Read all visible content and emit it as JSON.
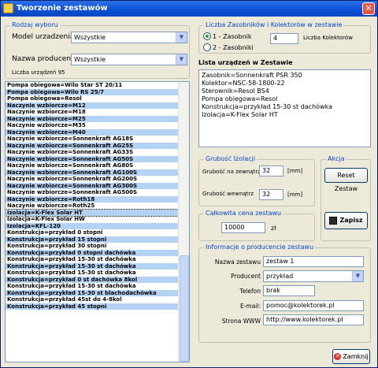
{
  "window": {
    "title": "Tworzenie zestawów",
    "close_glyph": "✕"
  },
  "rodzaj": {
    "title": "Rodzaj wyboru",
    "model_label": "Model urzadzenia",
    "model_value": "Wszystkie",
    "producer_label": "Nazwa producenta",
    "producer_value": "Wszystkie",
    "count_text": "Liczba urządzeń 95"
  },
  "list_items": [
    "Pompa obiegowa=Wilo Star ST 20/11",
    "Pompa obiegowa=Wilo RS 25/7",
    "Pompa obiegowa=Resol",
    "Naczynie wzbiorcze=M12",
    "Naczynie wzbiorcze=M18",
    "Naczynie wzbiorcze=M25",
    "Naczynie wzbiorcze=M35",
    "Naczynie wzbiorcze=M40",
    "Naczynie wzbiorcze=Sonnenkraft AG18S",
    "Naczynie wzbiorcze=Sonnenkraft AG25S",
    "Naczynie wzbiorcze=Sonnenkraft AG33S",
    "Naczynie wzbiorcze=Sonnenkraft AG50S",
    "Naczynie wzbiorcze=Sonnenkraft AG80S",
    "Naczynie wzbiorcze=Sonnenkraft AG100S",
    "Naczynie wzbiorcze=Sonnenkraft AG200S",
    "Naczynie wzbiorcze=Sonnenkraft AG300S",
    "Naczynie wzbiorcze=Sonnenkraft AG500S",
    "Naczynie wzbiorcze=Roth18",
    "Naczynie wzbiorcze=Roth25",
    "Izolacja=K-Flex Solar HT",
    "Izolacja=K-Flex Solar HW",
    "Izolacja=KFL-120",
    "Konstrukcja=przykład 0 stopni",
    "Konstrukcja=przykład 15 stopni",
    "Konstrukcja=przykład 30 stopni",
    "Konstrukcja=przykład 0 stopni dachówka",
    "Konstrukcja=przykład 15-30 st dachówka",
    "Konstrukcja=przykład 15-30 st dachówka",
    "Konstrukcja=przykład 15-30 st dachówka",
    "Konstrukcja=przykład 0 st dachówka 8kol",
    "Konstrukcja=przykład 15-30 st dachówka",
    "Konstrukcja=przykład 15-30 st blachodachówka",
    "Konstrukcja=przykład 45st do 4-8kol",
    "Konstrukcja=przykład 45 stopni"
  ],
  "liczba": {
    "title": "Liczba Zasobników i Kolektorów w  zestawie",
    "radio1": "1 - Zasobnik",
    "radio2": "2 - Zasobniki",
    "kolektory_value": "4",
    "kolektory_label": "Liczba Kolektorów"
  },
  "lista": {
    "title": "Lista urządzeń w Zestawie",
    "lines": [
      "Zasobnik=Sonnenkraft PSR 350",
      "Kolektor=NSC-58-1800-22",
      "Sterownik=Resol BS4",
      "Pompa obiegowa=Resol",
      "Konstrukcja=przykład 15-30 st dachówka",
      "Izolacja=K-Flex Solar HT"
    ]
  },
  "izolacja": {
    "title": "Grubość Izolacji",
    "outer_label": "Grubość na zewnątrz",
    "outer_value": "32",
    "inner_label": "Grubość wewnątrz",
    "inner_value": "32",
    "unit": "[mm]"
  },
  "akcja": {
    "title": "Akcja",
    "reset_label": "Reset Zestaw",
    "save_label": "Zapisz"
  },
  "cena": {
    "title": "Całkowita cena zestawu",
    "value": "10000",
    "unit": "zł"
  },
  "info": {
    "title": "Informacje o producencie zestawu",
    "name_label": "Nazwa zestawu",
    "name_value": "zestaw 1",
    "producer_label": "Producent",
    "producer_value": "przykład",
    "phone_label": "Telefon",
    "phone_value": "brak",
    "email_label": "E-mail:",
    "email_value": "pomoc@kolektorek.pl",
    "www_label": "Strona WWW",
    "www_value": "http://www.kolektorek.pl"
  },
  "footer": {
    "close_label": "Zamknij"
  },
  "colors": {
    "title_blue": "#0a4fd4",
    "list_alt": "#b4d2f2",
    "group_title": "#0046d5"
  }
}
